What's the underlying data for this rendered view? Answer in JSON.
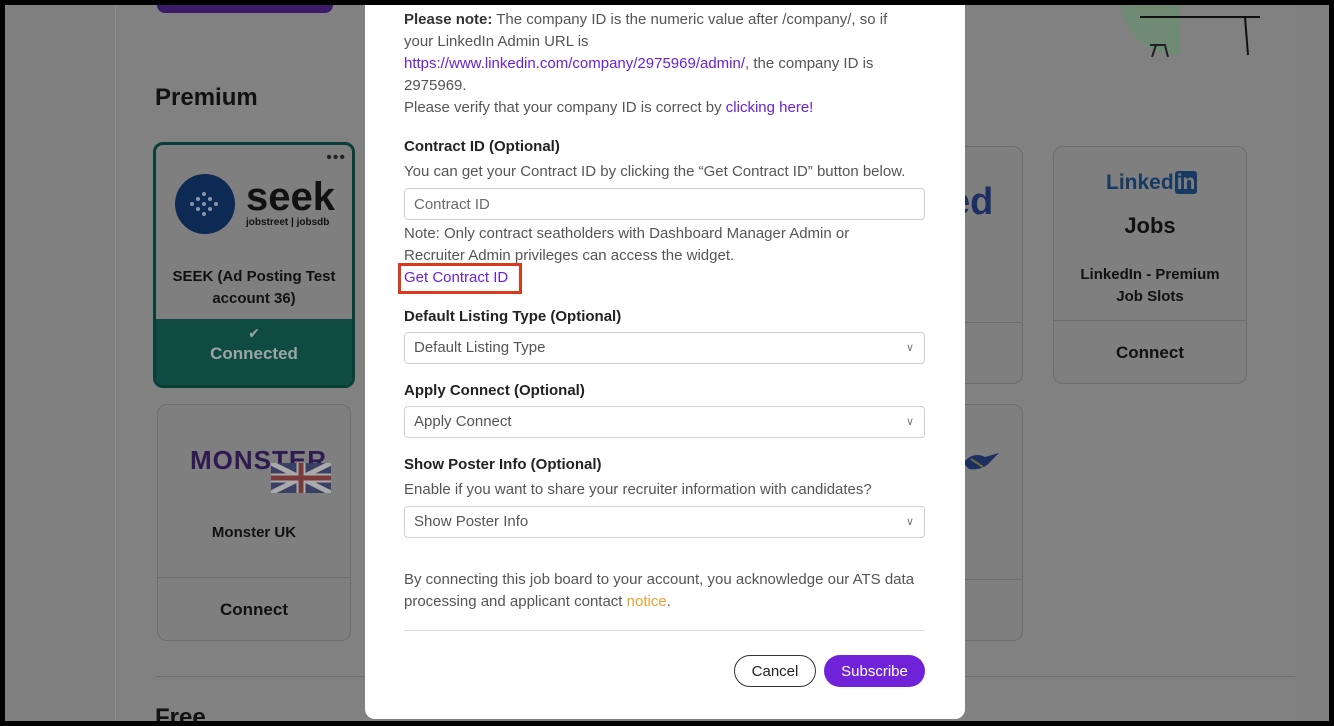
{
  "background": {
    "premium_title": "Premium",
    "free_title": "Free",
    "cards": {
      "seek": {
        "logo_main": "seek",
        "logo_sub": "jobstreet | jobsdb",
        "name": "SEEK (Ad Posting Test account 36)",
        "status": "Connected"
      },
      "monster": {
        "logo": "MONSTER",
        "name": "Monster UK",
        "action": "Connect"
      },
      "linkedin": {
        "logo": "Linked",
        "logo_in": "in",
        "logo_sub": "Jobs",
        "name": "LinkedIn - Premium Job Slots",
        "action": "Connect"
      },
      "partial_logo": "ed"
    }
  },
  "modal": {
    "note_bold": "Please note:",
    "note_line1": " The company ID is the numeric value after /company/, so if",
    "note_line2": "your LinkedIn Admin URL is",
    "note_url": "https://www.linkedin.com/company/2975969/admin/",
    "note_line3": ", the company ID is",
    "note_line4": "2975969.",
    "verify_text": "Please verify that your company ID is correct by ",
    "verify_link": "clicking here!",
    "contract_label": "Contract ID (Optional)",
    "contract_help": "You can get your Contract ID by clicking the “Get Contract ID” button below.",
    "contract_placeholder": "Contract ID",
    "contract_note_line1": "Note: Only contract seatholders with Dashboard Manager Admin or",
    "contract_note_line2": "Recruiter Admin privileges can access the widget.",
    "get_contract_link": "Get Contract ID",
    "listing_label": "Default Listing Type (Optional)",
    "listing_value": "Default Listing Type",
    "apply_label": "Apply Connect (Optional)",
    "apply_value": "Apply Connect",
    "poster_label": "Show Poster Info (Optional)",
    "poster_help": "Enable if you want to share your recruiter information with candidates?",
    "poster_value": "Show Poster Info",
    "consent_line1": "By connecting this job board to your account, you acknowledge our ATS data",
    "consent_line2": "processing and applicant contact ",
    "consent_link": "notice",
    "consent_end": ".",
    "cancel_label": "Cancel",
    "subscribe_label": "Subscribe"
  },
  "colors": {
    "accent": "#7022d9",
    "highlight": "#d9391c",
    "notice_link": "#e8a030",
    "seek_connected": "#0f4a43"
  }
}
